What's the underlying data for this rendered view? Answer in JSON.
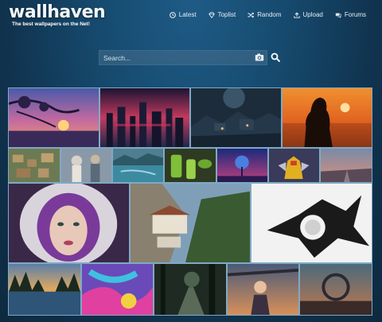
{
  "brand": {
    "logo_text": "wallhaven",
    "tagline": "The best wallpapers on the Net!"
  },
  "nav": {
    "items": [
      {
        "label": "Latest",
        "icon": "clock-icon"
      },
      {
        "label": "Toplist",
        "icon": "gem-icon"
      },
      {
        "label": "Random",
        "icon": "shuffle-icon"
      },
      {
        "label": "Upload",
        "icon": "upload-icon"
      },
      {
        "label": "Forums",
        "icon": "chat-icon"
      }
    ]
  },
  "search": {
    "placeholder": "Search...",
    "camera_icon": "camera-icon",
    "search_icon": "magnifier-icon"
  },
  "colors": {
    "accent": "#7fa9c4",
    "background": "#164a6e"
  }
}
